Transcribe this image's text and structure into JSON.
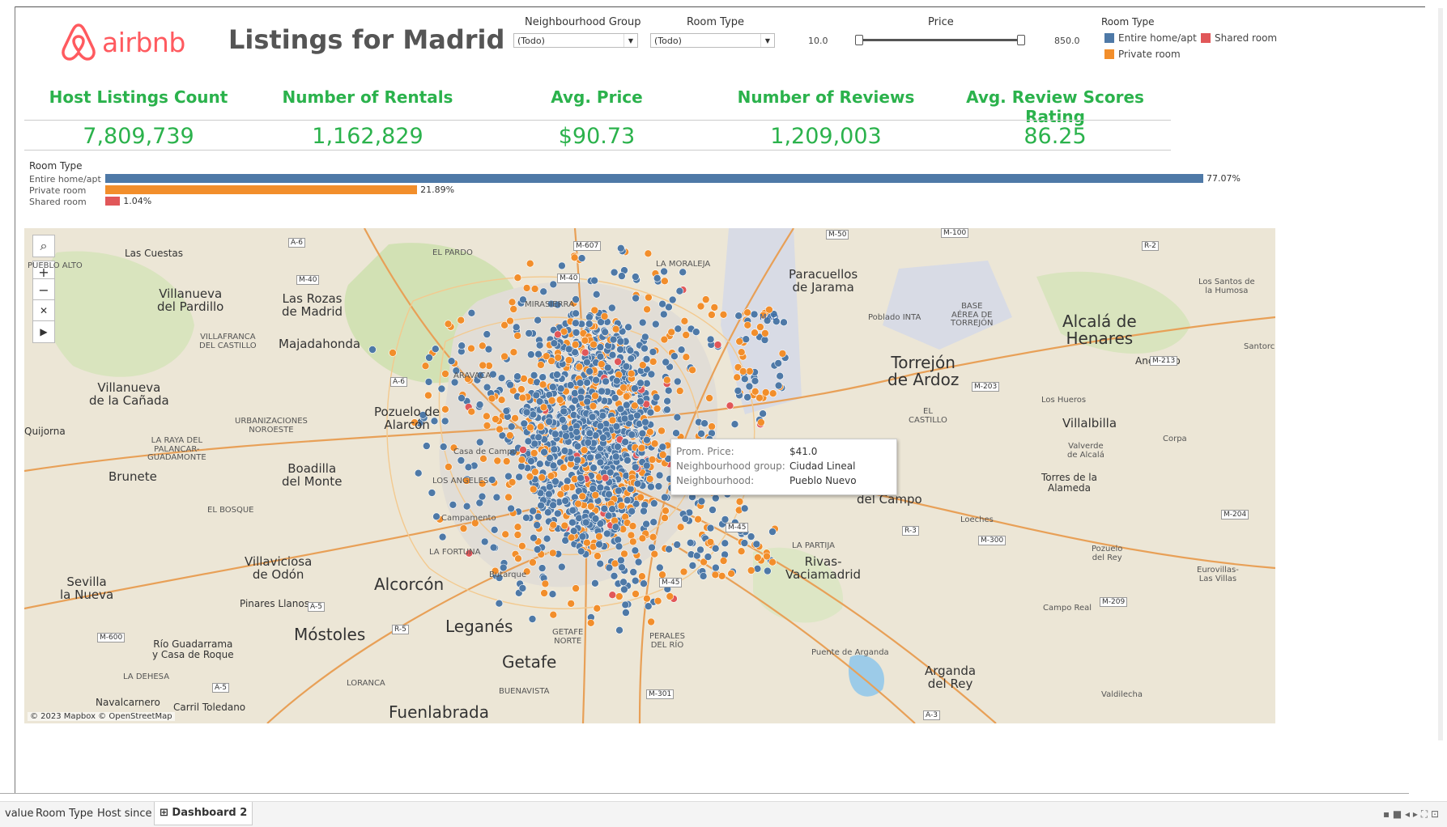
{
  "app": {
    "logo_text": "airbnb",
    "title": "Listings for Madrid"
  },
  "filters": {
    "neighbourhood_group": {
      "label": "Neighbourhood Group",
      "value": "(Todo)"
    },
    "room_type": {
      "label": "Room Type",
      "value": "(Todo)"
    },
    "price": {
      "label": "Price",
      "min": "10.0",
      "max": "850.0"
    }
  },
  "legend": {
    "title": "Room Type",
    "items": [
      {
        "label": "Entire home/apt",
        "color": "#4e79a7"
      },
      {
        "label": "Shared room",
        "color": "#e15759"
      },
      {
        "label": "Private room",
        "color": "#f28e2b"
      }
    ]
  },
  "kpis": [
    {
      "label": "Host Listings Count",
      "value": "7,809,739"
    },
    {
      "label": "Number of Rentals",
      "value": "1,162,829"
    },
    {
      "label": "Avg. Price",
      "value": "$90.73"
    },
    {
      "label": "Number of Reviews",
      "value": "1,209,003"
    },
    {
      "label": "Avg. Review Scores Rating",
      "value": "86.25"
    }
  ],
  "room_type_bars": {
    "title": "Room Type",
    "items": [
      {
        "label": "Entire home/apt",
        "pct": 77.07,
        "pct_label": "77.07%",
        "color": "#4e79a7"
      },
      {
        "label": "Private room",
        "pct": 21.89,
        "pct_label": "21.89%",
        "color": "#f28e2b"
      },
      {
        "label": "Shared room",
        "pct": 1.04,
        "pct_label": "1.04%",
        "color": "#e15759"
      }
    ]
  },
  "map": {
    "attribution": "© 2023 Mapbox © OpenStreetMap",
    "places": {
      "torrejon": "Torrejón\nde Ardoz",
      "alcala": "Alcalá de\nHenares",
      "alcorcon": "Alcorcón",
      "mostoles": "Móstoles",
      "leganes": "Leganés",
      "getafe": "Getafe",
      "fuenlabrada": "Fuenlabrada",
      "pozuelo": "Pozuelo de\nAlarcón",
      "rozas": "Las Rozas\nde Madrid",
      "majadahonda": "Majadahonda",
      "boadilla": "Boadilla\ndel Monte",
      "villaviciosa": "Villaviciosa\nde Odón",
      "villanueva_pardillo": "Villanueva\ndel Pardillo",
      "villanueva_canada": "Villanueva\nde la Cañada",
      "brunete": "Brunete",
      "sevilla": "Sevilla\nla Nueva",
      "rivas": "Rivas-\nVaciamadrid",
      "arganda": "Arganda\ndel Rey",
      "paracuellos": "Paracuellos\nde Jarama",
      "villalbilla": "Villalbilla",
      "torres": "Torres de la\nAlameda",
      "las_cuestas": "Las Cuestas",
      "quijorna": "Quijorna",
      "navalcarnero": "Navalcarnero",
      "pinares": "Pinares Llanos",
      "rio_guadarrama": "Río Guadarrama\ny Casa de Roque",
      "carril": "Carril Toledano",
      "poblado": "Poblado INTA",
      "anchuelo": "Anchuelo",
      "santorcaz": "Santorc",
      "los_santos": "Los Santos de\nla Humosa",
      "los_hueros": "Los Hueros",
      "valverde": "Valverde\nde Alcalá",
      "corpa": "Corpa",
      "loeches": "Loeches",
      "pozuelo_rey": "Pozuelo\ndel Rey",
      "eurovillas": "Eurovillas-\nLas Villas",
      "campo_real": "Campo Real",
      "valdilecha": "Valdilecha",
      "puente_arganda": "Puente de Arganda",
      "campamento": "Campamento",
      "butarque": "Butarque",
      "casa_campo": "Casa de Campo",
      "mad": "MAD",
      "la_partija": "LA PARTIJA",
      "el_pardo": "EL PARDO",
      "la_moraleja": "LA MORALEJA",
      "el_castillo": "EL\nCASTILLO",
      "base": "BASE\nAÉREA DE\nTORREJÓN",
      "urbanizaciones": "URBANIZACIONES\nNOROESTE",
      "raya": "LA RAYA DEL\nPALANCAR-\nGUADAMONTE",
      "bosque": "EL BOSQUE",
      "villafranca": "VILLAFRANCA\nDEL CASTILLO",
      "dehesa": "LA DEHESA",
      "los_angeles": "LOS ANGELES",
      "la_fortuna": "LA FORTUNA",
      "lorança": "LORANCA",
      "perales": "PERALES\nDEL RÍO",
      "getafe_norte": "GETAFE\nNORTE",
      "buenavista": "BUENAVISTA",
      "aravaca": "ARAVACA",
      "pueblo_alto": "PUEBLO ALTO",
      "mirasierra": "MIRASIERRA",
      "del_campo": "del Campo"
    },
    "roads": [
      "A-6",
      "M-607",
      "M-40",
      "M-50",
      "M-100",
      "R-2",
      "M-40",
      "A-6",
      "M-213",
      "M-203",
      "R-3",
      "M-300",
      "M-204",
      "M-45",
      "M-45",
      "A-5",
      "R-5",
      "M-600",
      "A-5",
      "M-301",
      "M-209",
      "A-3"
    ]
  },
  "tooltip": {
    "rows": [
      {
        "key": "Prom. Price:",
        "value": "$41.0"
      },
      {
        "key": "Neighbourhood group:",
        "value": "Ciudad Lineal"
      },
      {
        "key": "Neighbourhood:",
        "value": "Pueblo Nuevo"
      }
    ]
  },
  "tabs": [
    "value",
    "Room Type",
    "Host since",
    "Dashboard 2"
  ]
}
